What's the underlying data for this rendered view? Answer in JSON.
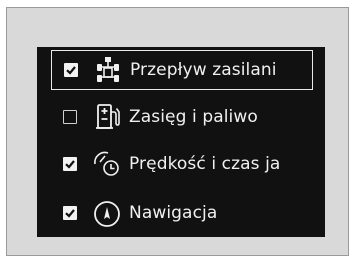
{
  "menu": {
    "items": [
      {
        "label": "Przepływ zasilani",
        "checked": true,
        "icon": "power-flow-icon"
      },
      {
        "label": "Zasięg i paliwo",
        "checked": false,
        "icon": "fuel-pump-icon"
      },
      {
        "label": "Prędkość i czas ja",
        "checked": true,
        "icon": "speed-time-icon"
      },
      {
        "label": "Nawigacja",
        "checked": true,
        "icon": "navigation-icon"
      }
    ]
  }
}
